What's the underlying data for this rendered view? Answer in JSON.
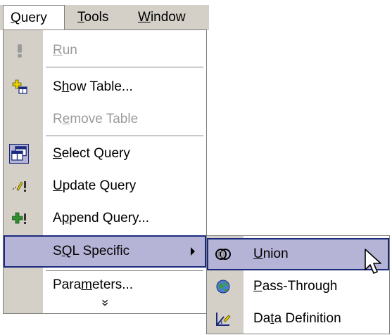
{
  "menubar": {
    "items": [
      {
        "pre": "",
        "key": "Q",
        "post": "uery",
        "active": true
      },
      {
        "pre": "",
        "key": "T",
        "post": "ools",
        "active": false
      },
      {
        "pre": "",
        "key": "W",
        "post": "indow",
        "active": false
      }
    ]
  },
  "query_menu": {
    "run": {
      "pre": "",
      "key": "R",
      "post": "un",
      "icon": "run-icon",
      "disabled": true
    },
    "show_table": {
      "pre": "S",
      "key": "h",
      "post": "ow Table...",
      "icon": "show-table-icon"
    },
    "remove_table": {
      "pre": "R",
      "key": "e",
      "post": "move Table",
      "disabled": true
    },
    "select_query": {
      "pre": "",
      "key": "S",
      "post": "elect Query",
      "icon": "select-query-icon"
    },
    "update_query": {
      "pre": "",
      "key": "U",
      "post": "pdate Query",
      "icon": "update-query-icon"
    },
    "append_query": {
      "pre": "A",
      "key": "p",
      "post": "pend Query...",
      "icon": "append-query-icon"
    },
    "sql_specific": {
      "pre": "S",
      "key": "Q",
      "post": "L Specific",
      "highlighted": true
    },
    "parameters": {
      "pre": "Para",
      "key": "m",
      "post": "eters...",
      "icon": ""
    },
    "more": "»"
  },
  "sql_submenu": {
    "union": {
      "pre": "",
      "key": "U",
      "post": "nion",
      "icon": "union-icon",
      "highlighted": true
    },
    "pass_through": {
      "pre": "",
      "key": "P",
      "post": "ass-Through",
      "icon": "globe-icon"
    },
    "data_definition": {
      "pre": "Da",
      "key": "t",
      "post": "a Definition",
      "icon": "data-definition-icon"
    }
  },
  "colors": {
    "highlight": "#b6b4d6",
    "highlight_border": "#1b2a7c",
    "menu_bg": "#d4d0c8",
    "disabled": "#9b9b9b"
  }
}
